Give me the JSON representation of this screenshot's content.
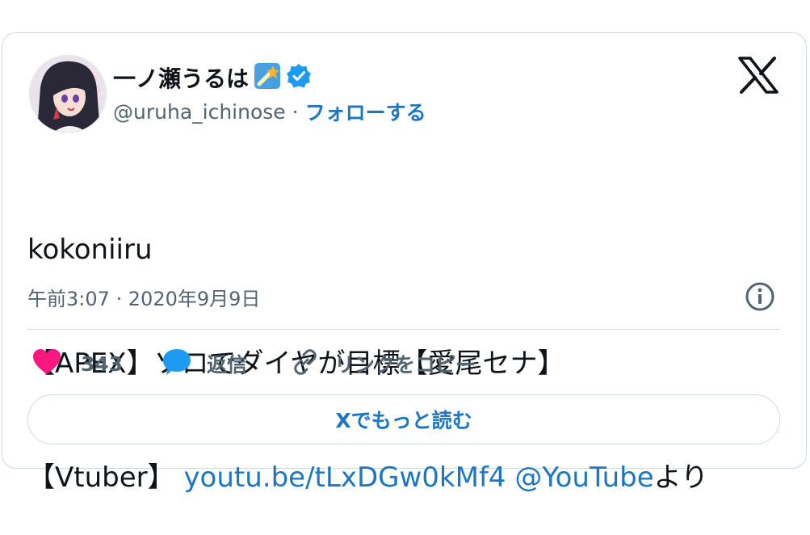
{
  "user": {
    "name": "一ノ瀬うるは",
    "handle": "@uruha_ichinose",
    "separator": "·",
    "follow_label": "フォローする"
  },
  "tweet": {
    "line1": "kokoniiru",
    "line2": "【APEX】ソロでダイヤが目標【愛尾セナ】",
    "line3_prefix": "【Vtuber】 ",
    "link": "youtu.be/tLxDGw0kMf4",
    "mention": "@YouTube",
    "suffix": "より",
    "timestamp": "午前3:07 · 2020年9月9日"
  },
  "actions": {
    "like_count": "343",
    "reply_label": "返信",
    "copy_link_label": "リンクをコピー"
  },
  "read_more_label": "Xでもっと読む",
  "icons": {
    "verified": "verified-badge-icon",
    "logo": "x-logo-icon",
    "info": "info-icon",
    "like": "heart-icon",
    "reply": "speech-bubble-icon",
    "copy": "link-icon"
  },
  "colors": {
    "accent": "#1d76c3",
    "verified": "#1d9bf0",
    "heart": "#f91880",
    "muted": "#536471"
  }
}
